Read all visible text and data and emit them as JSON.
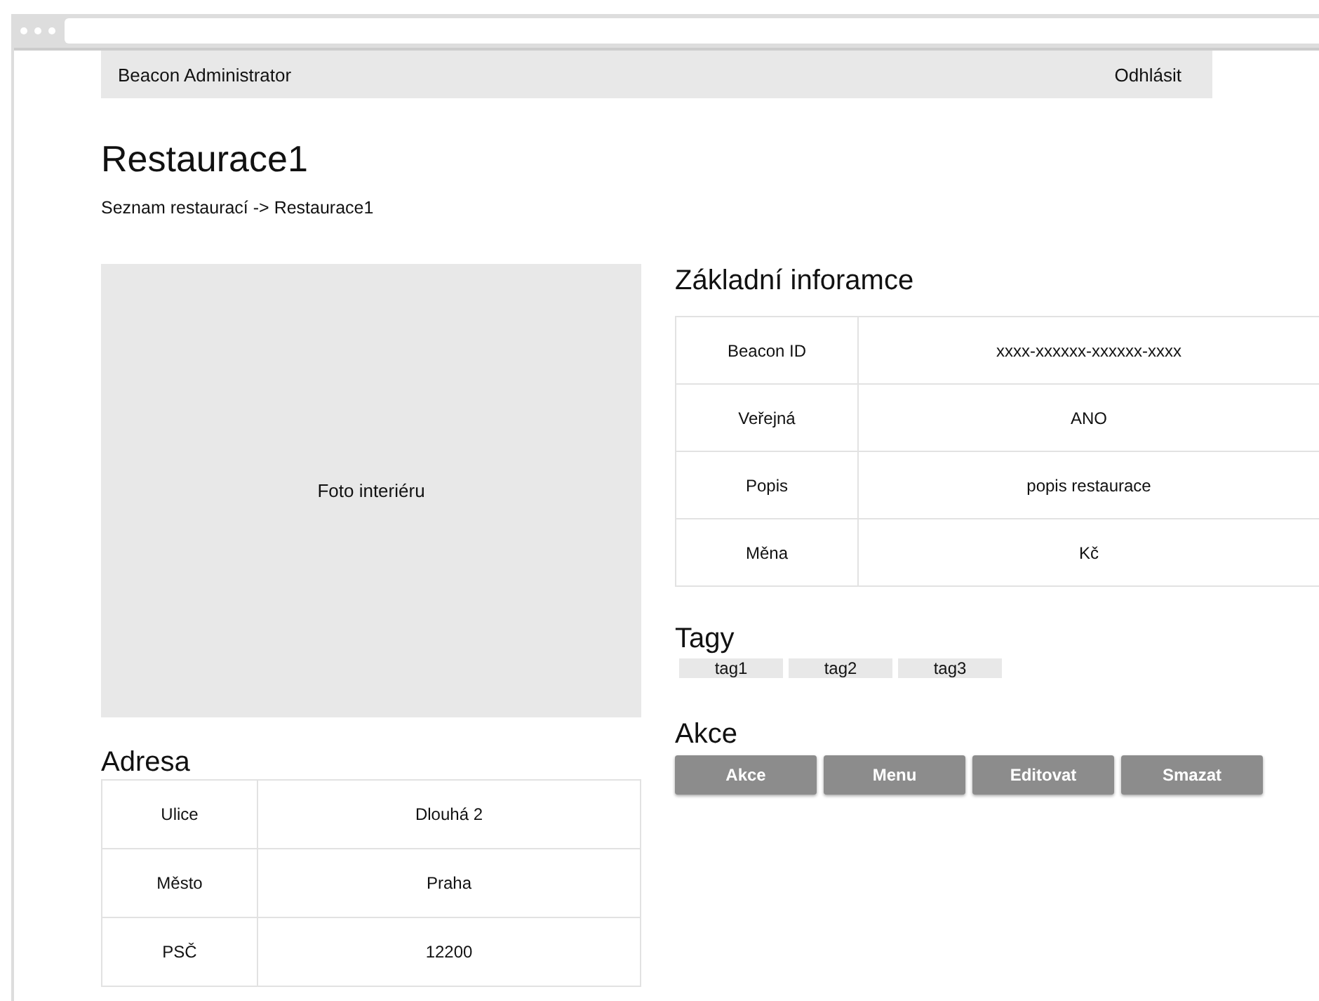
{
  "header": {
    "brand": "Beacon Administrator",
    "logout": "Odhlásit"
  },
  "title": "Restaurace1",
  "breadcrumb": "Seznam restaurací -> Restaurace1",
  "photo": {
    "label": "Foto interiéru"
  },
  "address": {
    "heading": "Adresa",
    "rows": [
      {
        "label": "Ulice",
        "value": "Dlouhá 2"
      },
      {
        "label": "Město",
        "value": "Praha"
      },
      {
        "label": "PSČ",
        "value": "12200"
      }
    ]
  },
  "info": {
    "heading": "Základní inforamce",
    "rows": [
      {
        "label": "Beacon ID",
        "value": "xxxx-xxxxxx-xxxxxx-xxxx"
      },
      {
        "label": "Veřejná",
        "value": "ANO"
      },
      {
        "label": "Popis",
        "value": "popis restaurace"
      },
      {
        "label": "Měna",
        "value": "Kč"
      }
    ]
  },
  "tags": {
    "heading": "Tagy",
    "items": [
      "tag1",
      "tag2",
      "tag3"
    ]
  },
  "actions": {
    "heading": "Akce",
    "buttons": [
      "Akce",
      "Menu",
      "Editovat",
      "Smazat"
    ]
  }
}
